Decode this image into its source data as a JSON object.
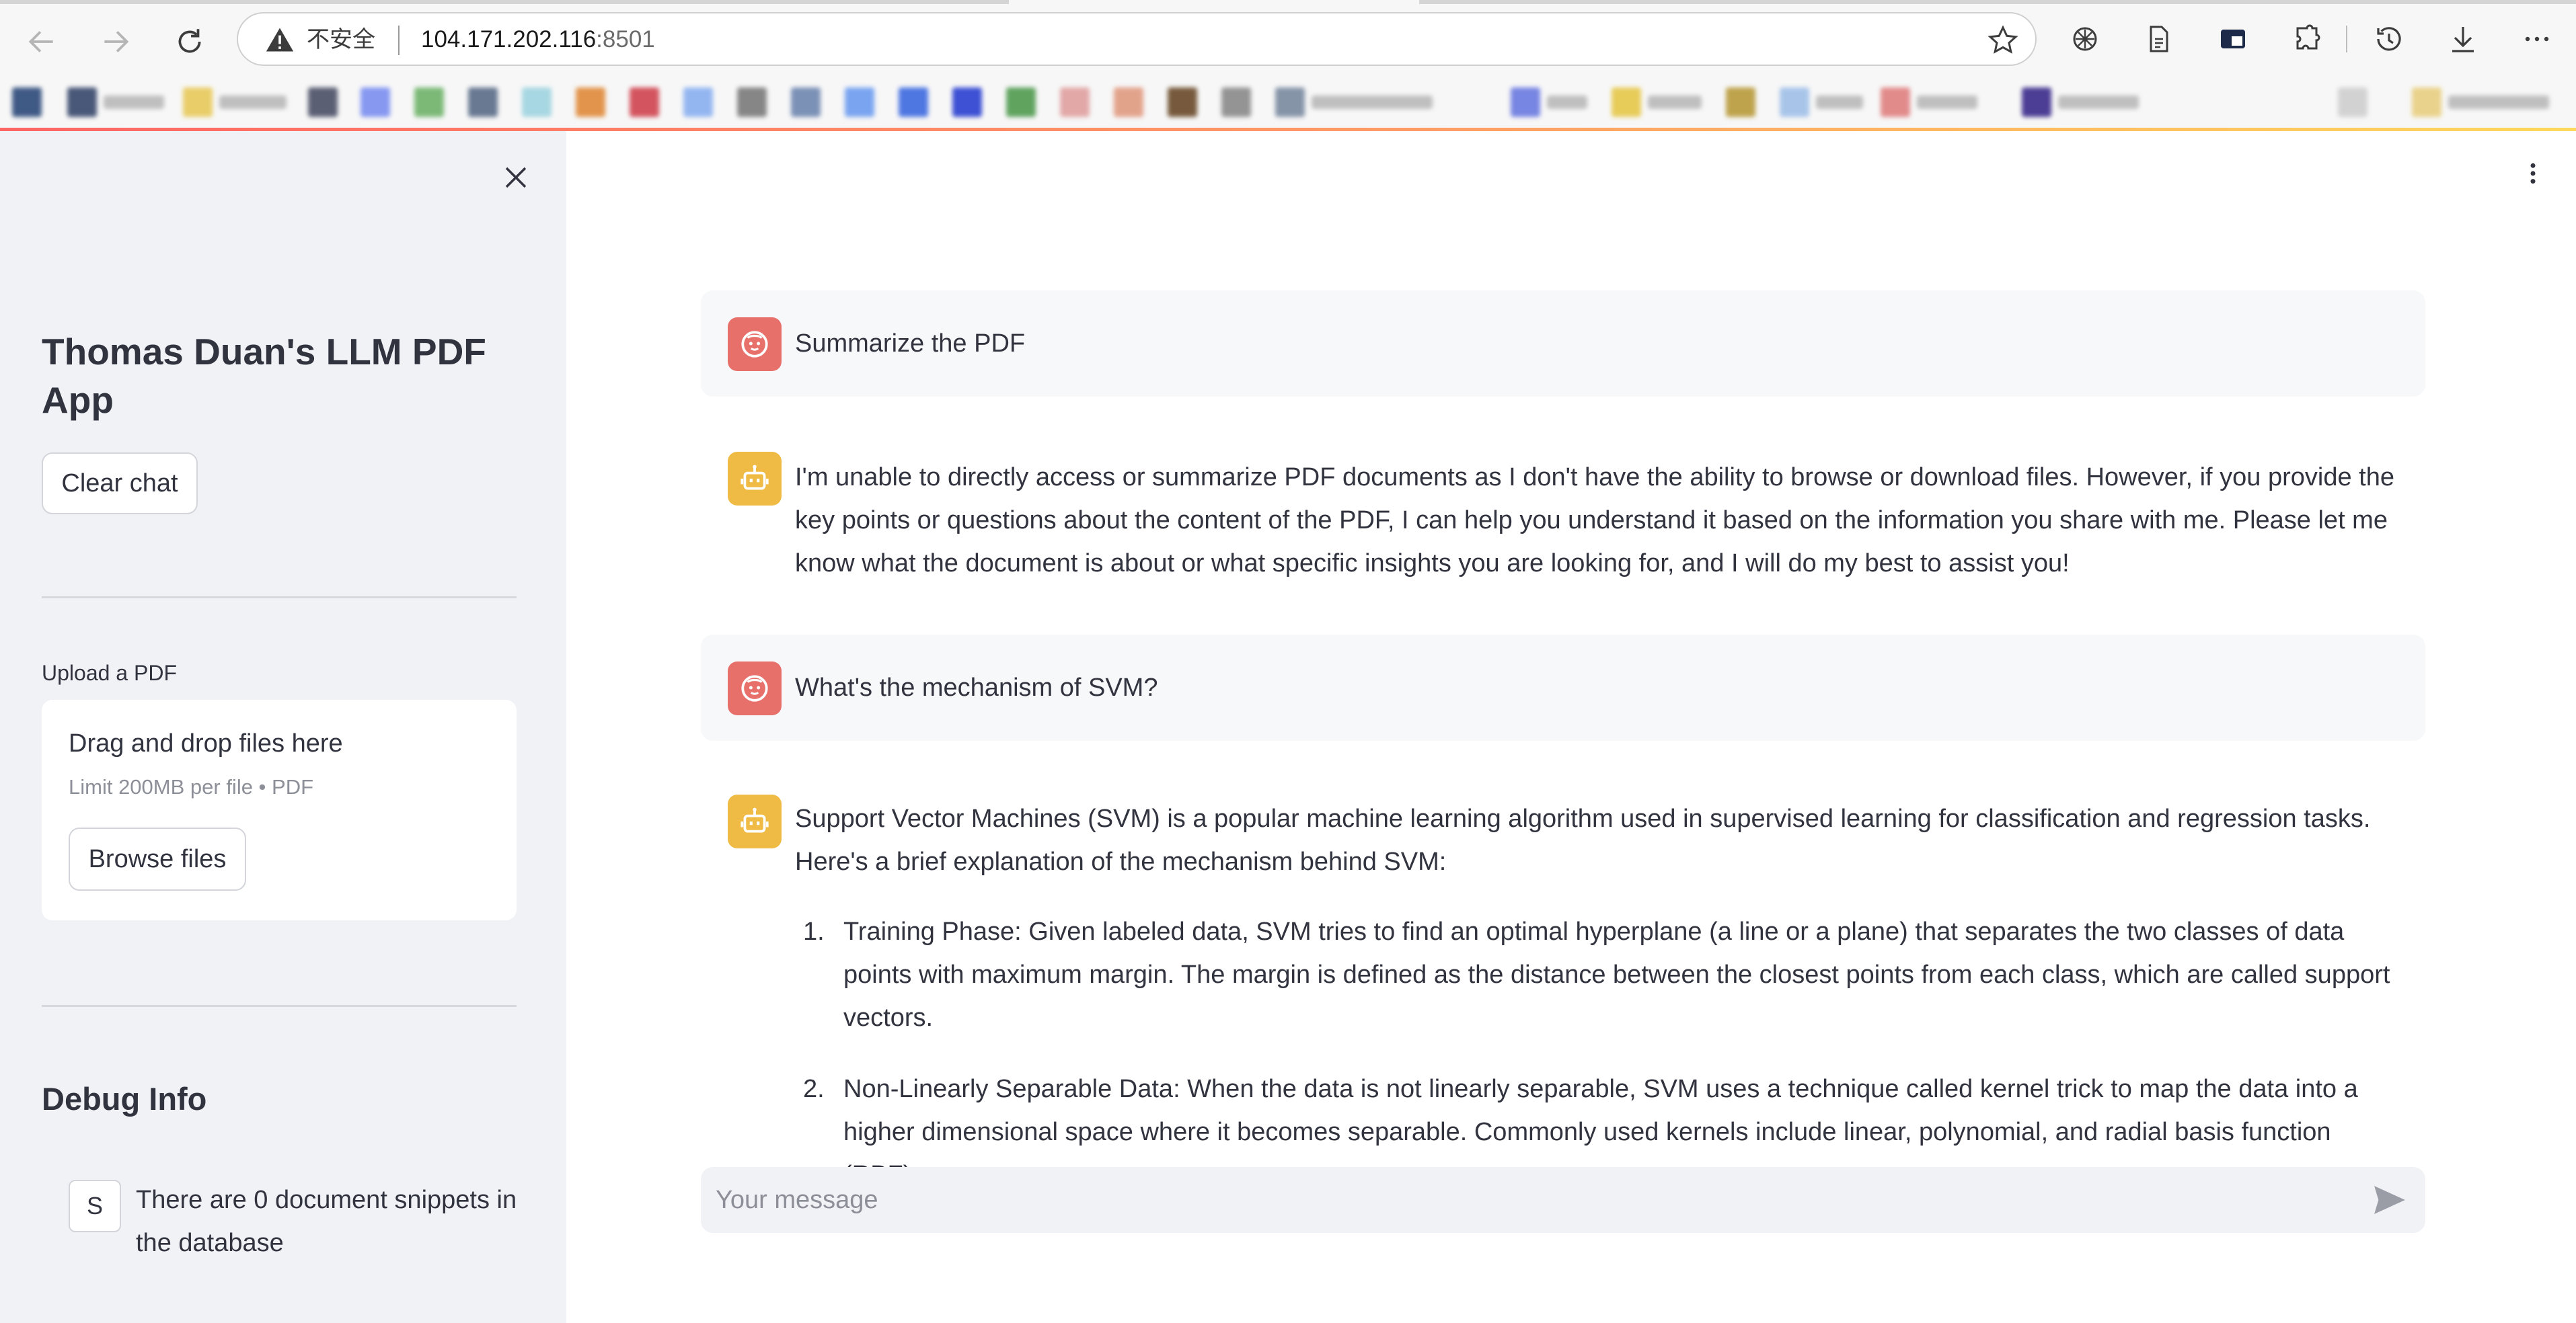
{
  "browser": {
    "security_label": "不安全",
    "url_host": "104.171.202.116",
    "url_port": ":8501"
  },
  "sidebar": {
    "title": "Thomas Duan's LLM PDF App",
    "clear_button": "Clear chat",
    "upload": {
      "label": "Upload a PDF",
      "drop_text": "Drag and drop files here",
      "limit_text": "Limit 200MB per file • PDF",
      "browse_button": "Browse files"
    },
    "debug": {
      "title": "Debug Info",
      "badge": "S",
      "text": "There are 0 document snippets in the database"
    }
  },
  "messages": [
    {
      "role": "user",
      "text": "Summarize the PDF"
    },
    {
      "role": "assistant",
      "text": "I'm unable to directly access or summarize PDF documents as I don't have the ability to browse or download files. However, if you provide the key points or questions about the content of the PDF, I can help you understand it based on the information you share with me. Please let me know what the document is about or what specific insights you are looking for, and I will do my best to assist you!"
    },
    {
      "role": "user",
      "text": "What's the mechanism of SVM?"
    },
    {
      "role": "assistant",
      "text": "Support Vector Machines (SVM) is a popular machine learning algorithm used in supervised learning for classification and regression tasks. Here's a brief explanation of the mechanism behind SVM:",
      "list": [
        {
          "num": "1.",
          "text": "Training Phase: Given labeled data, SVM tries to find an optimal hyperplane (a line or a plane) that separates the two classes of data points with maximum margin. The margin is defined as the distance between the closest points from each class, which are called support vectors."
        },
        {
          "num": "2.",
          "text": "Non-Linearly Separable Data: When the data is not linearly separable, SVM uses a technique called kernel trick to map the data into a higher dimensional space where it becomes separable. Commonly used kernels include linear, polynomial, and radial basis function (RBF)."
        }
      ]
    }
  ],
  "chat_input": {
    "placeholder": "Your message",
    "value": ""
  },
  "colors": {
    "user_avatar": "#e8706b",
    "assistant_avatar": "#f0bb45",
    "sidebar_bg": "#f0f2f6"
  }
}
